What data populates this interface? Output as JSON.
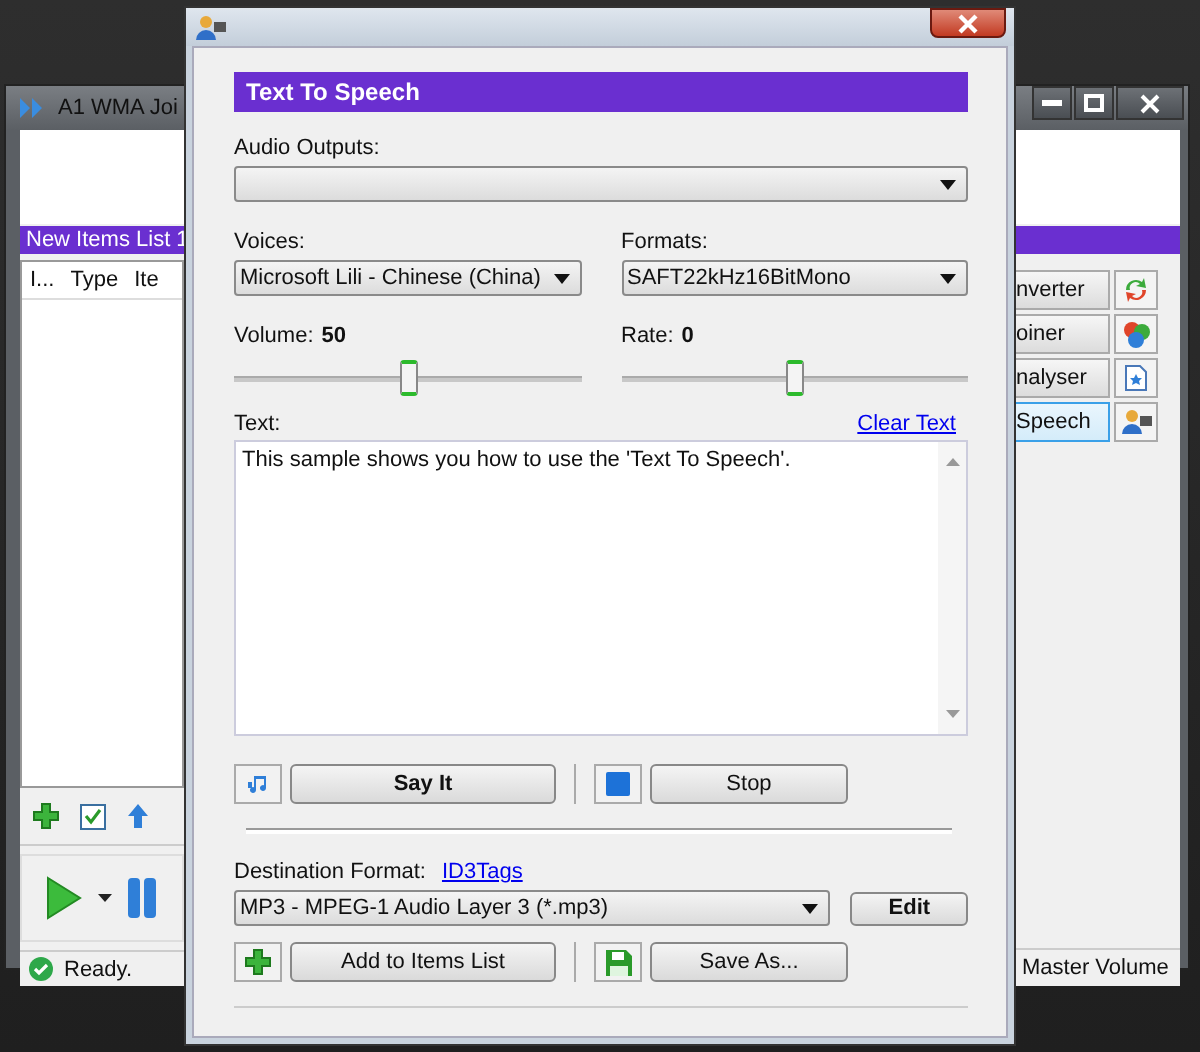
{
  "background_window": {
    "title": "A1 WMA Joi",
    "list_tab": "New Items List 1",
    "columns": [
      "I...",
      "Type",
      "Ite"
    ],
    "status": "Ready.",
    "side_buttons": [
      {
        "label": "nverter",
        "selected": false
      },
      {
        "label": "oiner",
        "selected": false
      },
      {
        "label": "nalyser",
        "selected": false
      },
      {
        "label": "Speech",
        "selected": true
      }
    ],
    "master_volume": "Master Volume"
  },
  "dialog": {
    "header": "Text To Speech",
    "audio_outputs": {
      "label": "Audio Outputs:"
    },
    "voices": {
      "label": "Voices:",
      "value": "Microsoft Lili - Chinese (China)"
    },
    "formats": {
      "label": "Formats:",
      "value": "SAFT22kHz16BitMono"
    },
    "volume": {
      "label": "Volume:",
      "reading": "50",
      "level": 0.5
    },
    "rate": {
      "label": "Rate:",
      "reading": "0",
      "level": 0.5
    },
    "text": {
      "label": "Text:",
      "value": "This sample shows you how to use the 'Text To Speech'.",
      "clear_link": "Clear Text"
    },
    "say_button": "Say It",
    "stop_button": "Stop",
    "destination": {
      "label": "Destination Format:",
      "link": "ID3Tags",
      "value": "MP3 - MPEG-1 Audio Layer 3 (*.mp3)",
      "edit_button": "Edit"
    },
    "add_button": "Add to Items List",
    "save_button": "Save As..."
  }
}
